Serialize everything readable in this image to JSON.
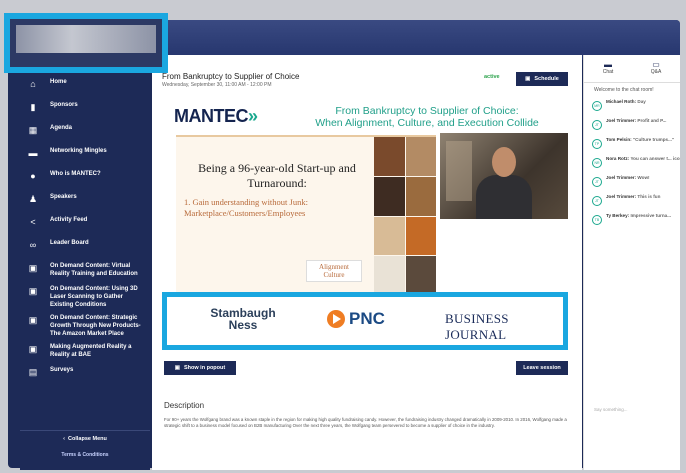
{
  "sidebar": {
    "items": [
      {
        "icon": "home-icon",
        "glyph": "⌂",
        "label": "Home"
      },
      {
        "icon": "sponsors-icon",
        "glyph": "▮",
        "label": "Sponsors"
      },
      {
        "icon": "calendar-icon",
        "glyph": "▦",
        "label": "Agenda"
      },
      {
        "icon": "chat-bubble-icon",
        "glyph": "▬",
        "label": "Networking Mingles"
      },
      {
        "icon": "info-icon",
        "glyph": "●",
        "label": "Who is MANTEC?"
      },
      {
        "icon": "people-icon",
        "glyph": "♟",
        "label": "Speakers"
      },
      {
        "icon": "share-icon",
        "glyph": "<",
        "label": "Activity Feed"
      },
      {
        "icon": "leaderboard-icon",
        "glyph": "∞",
        "label": "Leader Board"
      },
      {
        "icon": "on-demand-icon",
        "glyph": "▣",
        "label": "On Demand Content: Virtual Reality Training and Education"
      },
      {
        "icon": "on-demand-icon",
        "glyph": "▣",
        "label": "On Demand Content: Using 3D Laser Scanning to Gather Existing Conditions"
      },
      {
        "icon": "on-demand-icon",
        "glyph": "▣",
        "label": "On Demand Content: Strategic Growth Through New Products- The Amazon Market Place"
      },
      {
        "icon": "on-demand-icon",
        "glyph": "▣",
        "label": "Making Augmented Reality a Reality at BAE"
      },
      {
        "icon": "surveys-icon",
        "glyph": "▤",
        "label": "Surveys"
      }
    ],
    "collapse_label": "Collapse Menu",
    "terms_label": "Terms & Conditions"
  },
  "session": {
    "title": "From Bankruptcy to Supplier of Choice",
    "date": "Wednesday, September 30, 11:00 AM - 12:00 PM",
    "status": "active",
    "schedule_label": "Schedule",
    "popout_label": "Show in popout",
    "leave_label": "Leave session",
    "description_title": "Description",
    "description_text": "For 90+ years the Wolfgang brand was a known staple in the region for making high quality fundraising candy. However, the fundraising industry changed dramatically in 2009-2010. In 2016, Wolfgang made a strategic shift to a business model focused on B2B manufacturing Over the next three years, the Wolfgang team persevered to become a supplier of choice in the industry."
  },
  "slide": {
    "brand": "MANTEC",
    "brand_arrows": "»",
    "headline_1": "From Bankruptcy to Supplier of Choice:",
    "headline_2": "When Alignment, Culture, and Execution Collide",
    "heading": "Being a 96-year-old Start-up and Turnaround:",
    "bullet": "1.  Gain understanding without Junk: Marketplace/Customers/Employees",
    "alignment_1": "Alignment",
    "alignment_2": "Culture"
  },
  "sponsors": {
    "stambaugh": "Stambaugh Ness",
    "pnc": "PNC",
    "journal": "BUSINESS JOURNAL"
  },
  "chat": {
    "tab_chat": "Chat",
    "tab_qa": "Q&A",
    "welcome": "Welcome to the chat room!",
    "input_placeholder": "Say something...",
    "messages": [
      {
        "initials": "MR",
        "name": "Michael Roth",
        "text": "Day"
      },
      {
        "initials": "JT",
        "name": "Joel Trimmer",
        "text": "Profit and P..."
      },
      {
        "initials": "TP",
        "name": "Tom Pelsin",
        "text": "\"Culture trumps...\""
      },
      {
        "initials": "NR",
        "name": "Nora Rotz",
        "text": "You can answer t... icon"
      },
      {
        "initials": "JT",
        "name": "Joel Trimmer",
        "text": "Wow!"
      },
      {
        "initials": "JT",
        "name": "Joel Trimmer",
        "text": "This is fun"
      },
      {
        "initials": "TB",
        "name": "Ty Berkey",
        "text": "Impressive turna..."
      }
    ]
  },
  "colors": {
    "navy": "#1d2a57",
    "highlight": "#1aa7e0",
    "teal": "#1aa88e",
    "active_green": "#2aa24a"
  }
}
